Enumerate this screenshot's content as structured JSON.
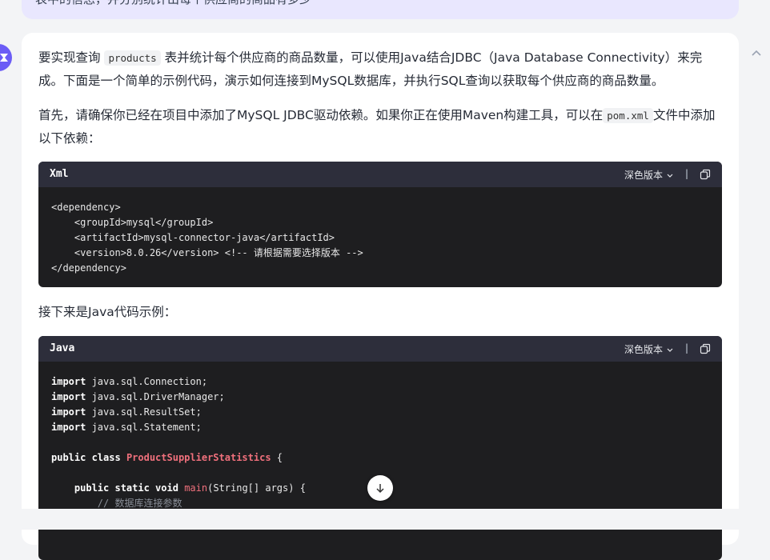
{
  "user_message": {
    "text": "表中的信息，并分别统计出每个供应商的商品有多少"
  },
  "answer": {
    "intro_before_code": "要实现查询",
    "intro_code": "products",
    "intro_after_code": "表并统计每个供应商的商品数量，可以使用Java结合JDBC（Java Database Connectivity）来完成。下面是一个简单的示例代码，演示如何连接到MySQL数据库，并执行SQL查询以获取每个供应商的商品数量。",
    "para2_before": "首先，请确保你已经在项目中添加了MySQL JDBC驱动依赖。如果你正在使用Maven构建工具，可以在",
    "para2_code": "pom.xml",
    "para2_after": "文件中添加以下依赖：",
    "para3": "接下来是Java代码示例："
  },
  "code_blocks": [
    {
      "lang": "Xml",
      "theme_label": "深色版本",
      "lines": [
        "<dependency>",
        "    <groupId>mysql</groupId>",
        "    <artifactId>mysql-connector-java</artifactId>",
        "    <version>8.0.26</version> <!-- 请根据需要选择版本 -->",
        "</dependency>"
      ]
    },
    {
      "lang": "Java",
      "theme_label": "深色版本",
      "imports": [
        {
          "kw": "import",
          "rest": " java.sql.Connection;"
        },
        {
          "kw": "import",
          "rest": " java.sql.DriverManager;"
        },
        {
          "kw": "import",
          "rest": " java.sql.ResultSet;"
        },
        {
          "kw": "import",
          "rest": " java.sql.Statement;"
        }
      ],
      "class_kw": "public class",
      "class_name": "ProductSupplierStatistics",
      "class_open": " {",
      "method_kw": "public static void",
      "method_name": "main",
      "method_rest": "(String[] args) {",
      "comment": "// 数据库连接参数"
    }
  ],
  "icons": {
    "avatar": "assistant-logo-icon",
    "collapse": "chevron-up-icon",
    "copy": "copy-icon",
    "scroll": "arrow-down-icon"
  },
  "colors": {
    "accent": "#6b5cf6",
    "code_bg": "#1e1e20",
    "code_header": "#2d2e3b",
    "keyword_red": "#f0707c"
  }
}
